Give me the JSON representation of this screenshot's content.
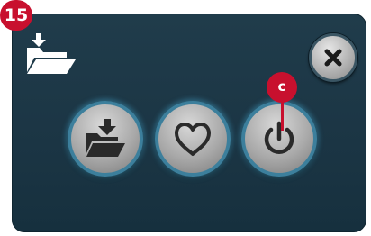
{
  "step_badge": "15",
  "callout_label": "c",
  "header": {
    "icon": "folder-load-icon"
  },
  "buttons": {
    "close": {
      "icon": "close-icon"
    },
    "load": {
      "icon": "folder-load-icon"
    },
    "favorites": {
      "icon": "heart-icon"
    },
    "power": {
      "icon": "power-icon"
    }
  },
  "colors": {
    "panel": "#1b3544",
    "badge": "#c8102e",
    "button_glow": "#3c7f9c"
  }
}
